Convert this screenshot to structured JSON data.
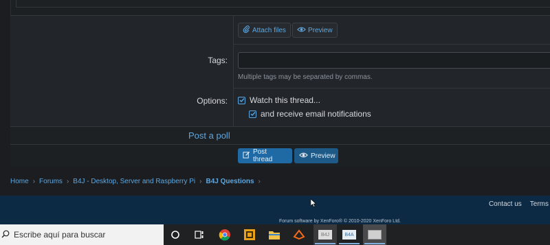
{
  "editor": {
    "attach_label": "Attach files",
    "preview_label": "Preview"
  },
  "tags": {
    "label": "Tags:",
    "hint": "Multiple tags may be separated by commas."
  },
  "options": {
    "label": "Options:",
    "watch_label": "Watch this thread...",
    "email_label": "and receive email notifications",
    "watch_checked": true,
    "email_checked": true
  },
  "poll": {
    "label": "Post a poll"
  },
  "actions": {
    "post_thread": "Post thread",
    "preview": "Preview",
    "primary_color": "#1f6aa5",
    "secondary_color": "#1e5a88"
  },
  "breadcrumb": {
    "items": [
      "Home",
      "Forums",
      "B4J - Desktop, Server and Raspberry Pi",
      "B4J Questions"
    ]
  },
  "footer": {
    "contact": "Contact us",
    "terms": "Terms",
    "credit": "Forum software by XenForo® © 2010-2020 XenForo Ltd."
  },
  "taskbar": {
    "search_placeholder": "Escribe aquí para buscar",
    "apps": [
      "cortana-icon",
      "task-view-icon",
      "chrome-icon",
      "app-icon",
      "file-explorer-icon",
      "app-icon",
      "b4j-icon",
      "b4a-icon",
      "b4x-icon"
    ],
    "b4j_label": "B4J",
    "b4a_label": "B4A"
  }
}
